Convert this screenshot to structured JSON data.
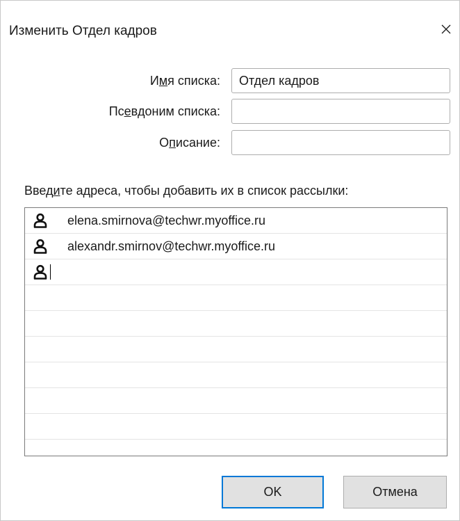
{
  "window": {
    "title": "Изменить Отдел кадров",
    "close_glyph": "close-icon"
  },
  "form": {
    "list_name": {
      "label_before": "И",
      "label_mnemonic": "м",
      "label_after": "я списка:",
      "value": "Отдел кадров",
      "placeholder": ""
    },
    "alias": {
      "label_before": "Пс",
      "label_mnemonic": "е",
      "label_after": "вдоним списка:",
      "value": "",
      "placeholder": ""
    },
    "description": {
      "label_before": "О",
      "label_mnemonic": "п",
      "label_after": "исание:",
      "value": "",
      "placeholder": ""
    }
  },
  "recipients": {
    "instruction_before": "Введ",
    "instruction_mnemonic": "и",
    "instruction_after": "те адреса, чтобы добавить их в список рассылки:",
    "items": [
      {
        "email": "elena.smirnova@techwr.myoffice.ru",
        "icon": "person-icon"
      },
      {
        "email": "alexandr.smirnov@techwr.myoffice.ru",
        "icon": "person-icon"
      },
      {
        "email": "",
        "icon": "person-icon"
      }
    ],
    "empty_row_count": 6
  },
  "buttons": {
    "ok_label": "OK",
    "cancel_label": "Отмена"
  },
  "colors": {
    "accent_focus": "#0078d7",
    "button_bg": "#e1e1e1",
    "border": "#adadad"
  }
}
